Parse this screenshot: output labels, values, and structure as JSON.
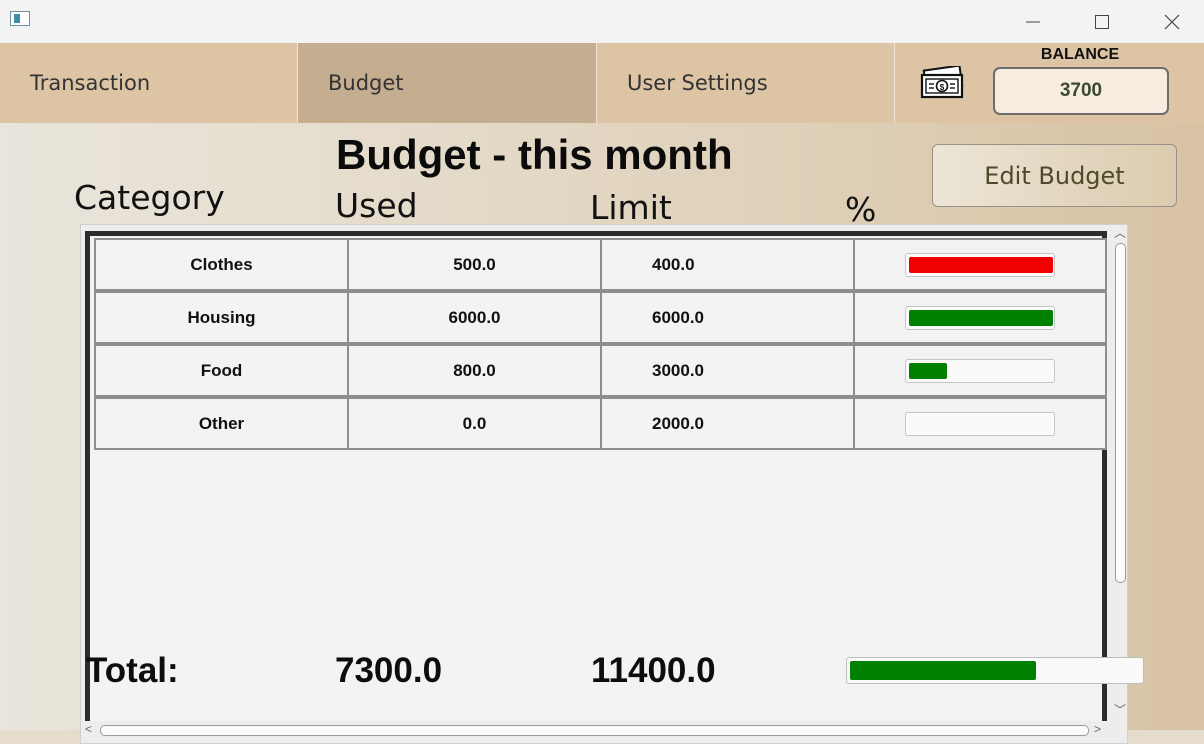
{
  "tabs": [
    {
      "label": "Transaction"
    },
    {
      "label": "Budget",
      "active": true
    },
    {
      "label": "User Settings"
    }
  ],
  "balance": {
    "label": "BALANCE",
    "value": "3700",
    "icon": "money-bill-icon"
  },
  "page": {
    "title": "Budget - this month",
    "edit_button": "Edit Budget",
    "columns": {
      "category": "Category",
      "used": "Used",
      "limit": "Limit",
      "percent": "%"
    }
  },
  "rows": [
    {
      "category": "Clothes",
      "used": "500.0",
      "limit": "400.0",
      "fraction": 1.0,
      "color": "#f00000"
    },
    {
      "category": "Housing",
      "used": "6000.0",
      "limit": "6000.0",
      "fraction": 1.0,
      "color": "#008000"
    },
    {
      "category": "Food",
      "used": "800.0",
      "limit": "3000.0",
      "fraction": 0.2667,
      "color": "#008000"
    },
    {
      "category": "Other",
      "used": "0.0",
      "limit": "2000.0",
      "fraction": 0.0,
      "color": "#008000"
    }
  ],
  "totals": {
    "label": "Total:",
    "used": "7300.0",
    "limit": "11400.0",
    "fraction": 0.64,
    "color": "#008000"
  }
}
